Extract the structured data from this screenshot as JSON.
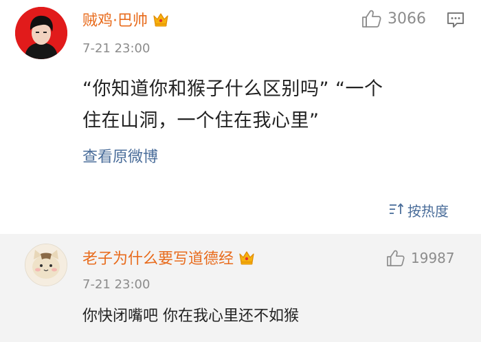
{
  "main_comment": {
    "username": "贼鸡·巴帅",
    "timestamp": "7-21 23:00",
    "like_count": "3066",
    "content_lines": [
      "“你知道你和猴子什么区别吗” “一个",
      "住在山洞，一个住在我心里”"
    ],
    "view_original_label": "查看原微博",
    "sort_label": "按热度"
  },
  "reply": {
    "username": "老子为什么要写道德经",
    "timestamp": "7-21 23:00",
    "like_count": "19987",
    "content": "你快闭嘴吧 你在我心里还不如猴"
  },
  "colors": {
    "username": "#e86b1c",
    "link": "#4a6d9a",
    "meta": "#8c8c8c",
    "reply_background": "#f3f3f3"
  },
  "icons": {
    "vip": "crown-vip-icon",
    "like": "thumbs-up-icon",
    "comment": "comment-icon",
    "sort": "sort-icon"
  }
}
